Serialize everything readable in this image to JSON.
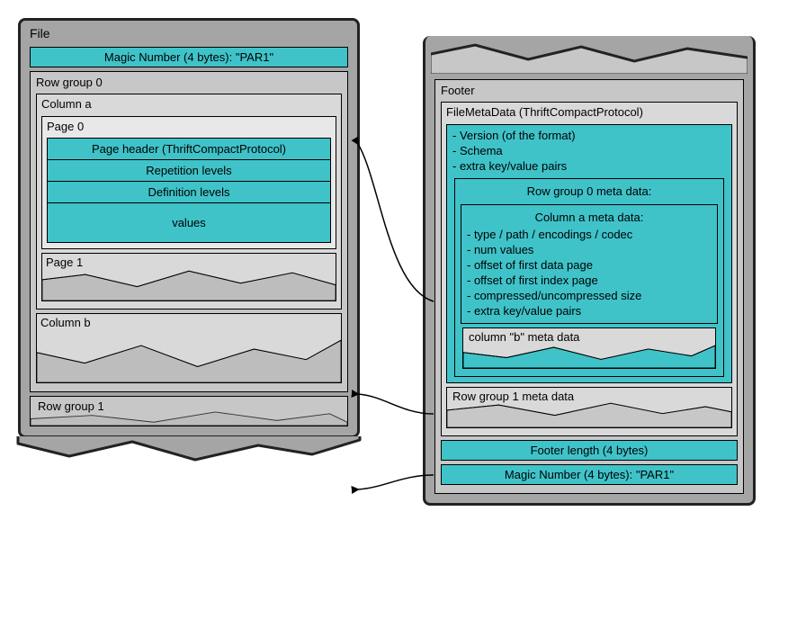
{
  "file": {
    "label": "File",
    "magic": "Magic Number (4 bytes): \"PAR1\"",
    "row_group0": {
      "label": "Row group 0",
      "columnA": {
        "label": "Column a",
        "page0": {
          "label": "Page 0",
          "header": "Page header (ThriftCompactProtocol)",
          "rep": "Repetition levels",
          "def": "Definition levels",
          "values": "values"
        },
        "page1": {
          "label": "Page 1"
        }
      },
      "columnB": {
        "label": "Column b"
      }
    },
    "row_group1": {
      "label": "Row group 1"
    }
  },
  "footer": {
    "label": "Footer",
    "filemeta": {
      "label": "FileMetaData (ThriftCompactProtocol)",
      "lines": {
        "version": "- Version (of the format)",
        "schema": "- Schema",
        "extra": "- extra key/value pairs"
      },
      "rg0": {
        "label": "Row group 0 meta data:",
        "colA": {
          "label": "Column a meta data:",
          "l1": "- type / path / encodings / codec",
          "l2": "- num values",
          "l3": "- offset of first data page",
          "l4": "- offset of first index page",
          "l5": "- compressed/uncompressed size",
          "l6": "- extra key/value pairs"
        },
        "colB": {
          "label": "column \"b\" meta data"
        }
      },
      "rg1": {
        "label": "Row group 1 meta data"
      }
    },
    "footer_len": "Footer length (4 bytes)",
    "magic": "Magic Number (4 bytes): \"PAR1\""
  }
}
